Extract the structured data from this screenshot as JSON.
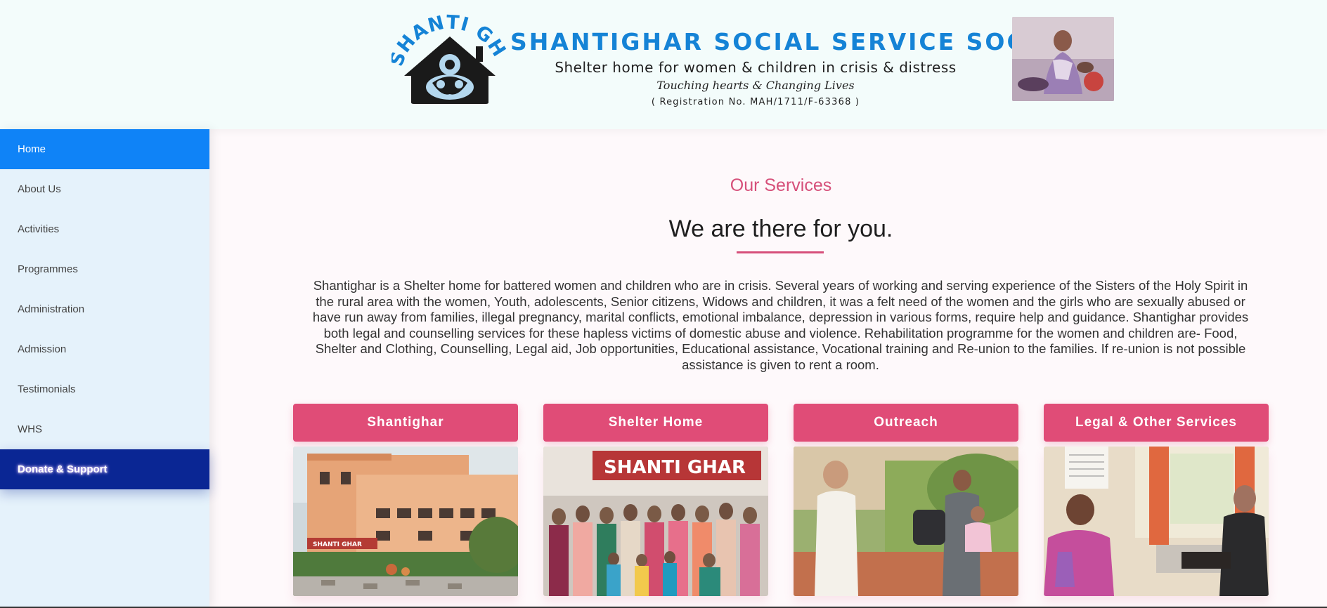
{
  "header": {
    "logo_text": "SHANTI GHAR",
    "org_name": "SHANTIGHAR SOCIAL SERVICE SOCIETY",
    "tagline": "Shelter home for women & children in crisis & distress",
    "motto": "Touching hearts & Changing Lives",
    "registration": "( Registration No. MAH/1711/F-63368 )"
  },
  "sidebar": {
    "items": [
      {
        "label": "Home"
      },
      {
        "label": "About Us"
      },
      {
        "label": "Activities"
      },
      {
        "label": "Programmes"
      },
      {
        "label": "Administration"
      },
      {
        "label": "Admission"
      },
      {
        "label": "Testimonials"
      },
      {
        "label": "WHS"
      },
      {
        "label": "Donate & Support"
      }
    ]
  },
  "main": {
    "eyebrow": "Our Services",
    "title": "We are there for you.",
    "intro": "Shantighar is a Shelter home for battered women and children who are in crisis. Several years of working and serving experience of the Sisters of the Holy Spirit in the rural area with the women, Youth, adolescents, Senior citizens, Widows and children, it was a felt need of the women and the girls who are sexually abused or have run away from families, illegal pregnancy, marital conflicts, emotional imbalance, depression in various forms, require help and guidance. Shantighar provides both legal and counselling services for these hapless victims of domestic abuse and violence. Rehabilitation programme for the women and children are- Food, Shelter and Clothing, Counselling, Legal aid, Job opportunities, Educational assistance, Vocational training and Re-union to the families. If re-union is not possible assistance is given to rent a room.",
    "cards": [
      {
        "title": "Shantighar",
        "photo_sign": "SHANTI GHAR"
      },
      {
        "title": "Shelter Home",
        "photo_sign": "SHANTI GHAR"
      },
      {
        "title": "Outreach"
      },
      {
        "title": "Legal & Other Services"
      }
    ]
  },
  "colors": {
    "brand_blue": "#1583d6",
    "active_nav": "#0f83f7",
    "donate_nav": "#0a2694",
    "accent_pink": "#e04c77"
  }
}
